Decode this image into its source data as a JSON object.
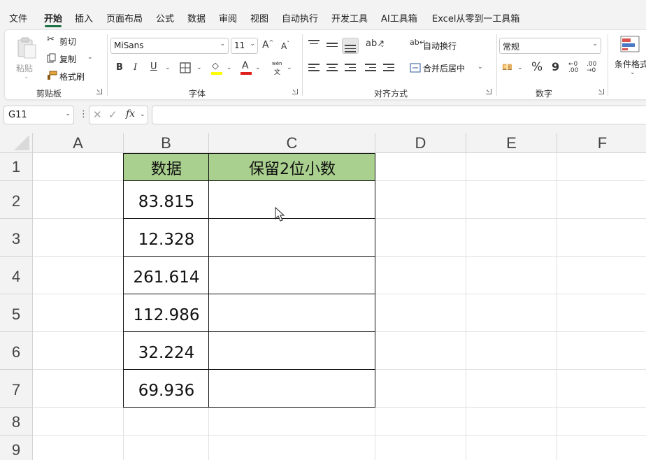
{
  "menu": {
    "tabs": [
      "文件",
      "开始",
      "插入",
      "页面布局",
      "公式",
      "数据",
      "审阅",
      "视图",
      "自动执行",
      "开发工具",
      "AI工具箱",
      "Excel从零到一工具箱"
    ],
    "active": "开始"
  },
  "ribbon": {
    "clipboard": {
      "paste": "粘贴",
      "cut": "剪切",
      "copy": "复制",
      "format_painter": "格式刷",
      "label": "剪贴板"
    },
    "font": {
      "font_name": "MiSans",
      "font_size": "11",
      "grow": "A",
      "shrink": "A",
      "bold": "B",
      "italic": "I",
      "underline": "U",
      "font_color_glyph": "A",
      "phonetic_top": "wén",
      "phonetic_bottom": "文",
      "fill_color": "#ffff00",
      "font_color": "#e0201b",
      "label": "字体"
    },
    "alignment": {
      "wrap_text": "自动换行",
      "merge_center": "合并后居中",
      "label": "对齐方式"
    },
    "number": {
      "format": "常规",
      "percent": "%",
      "comma": "9",
      "label": "数字"
    },
    "styles": {
      "conditional": "条件格式"
    }
  },
  "formula_bar": {
    "name_box": "G11",
    "fx": "fx",
    "formula": ""
  },
  "sheet": {
    "columns": [
      "A",
      "B",
      "C",
      "D",
      "E",
      "F"
    ],
    "rows": [
      "1",
      "2",
      "3",
      "4",
      "5",
      "6",
      "7",
      "8",
      "9"
    ],
    "header_fill": "#a9d08e",
    "table": {
      "headers": [
        "数据",
        "保留2位小数"
      ],
      "rows": [
        [
          "83.815",
          ""
        ],
        [
          "12.328",
          ""
        ],
        [
          "261.614",
          ""
        ],
        [
          "112.986",
          ""
        ],
        [
          "32.224",
          ""
        ],
        [
          "69.936",
          ""
        ]
      ]
    }
  }
}
